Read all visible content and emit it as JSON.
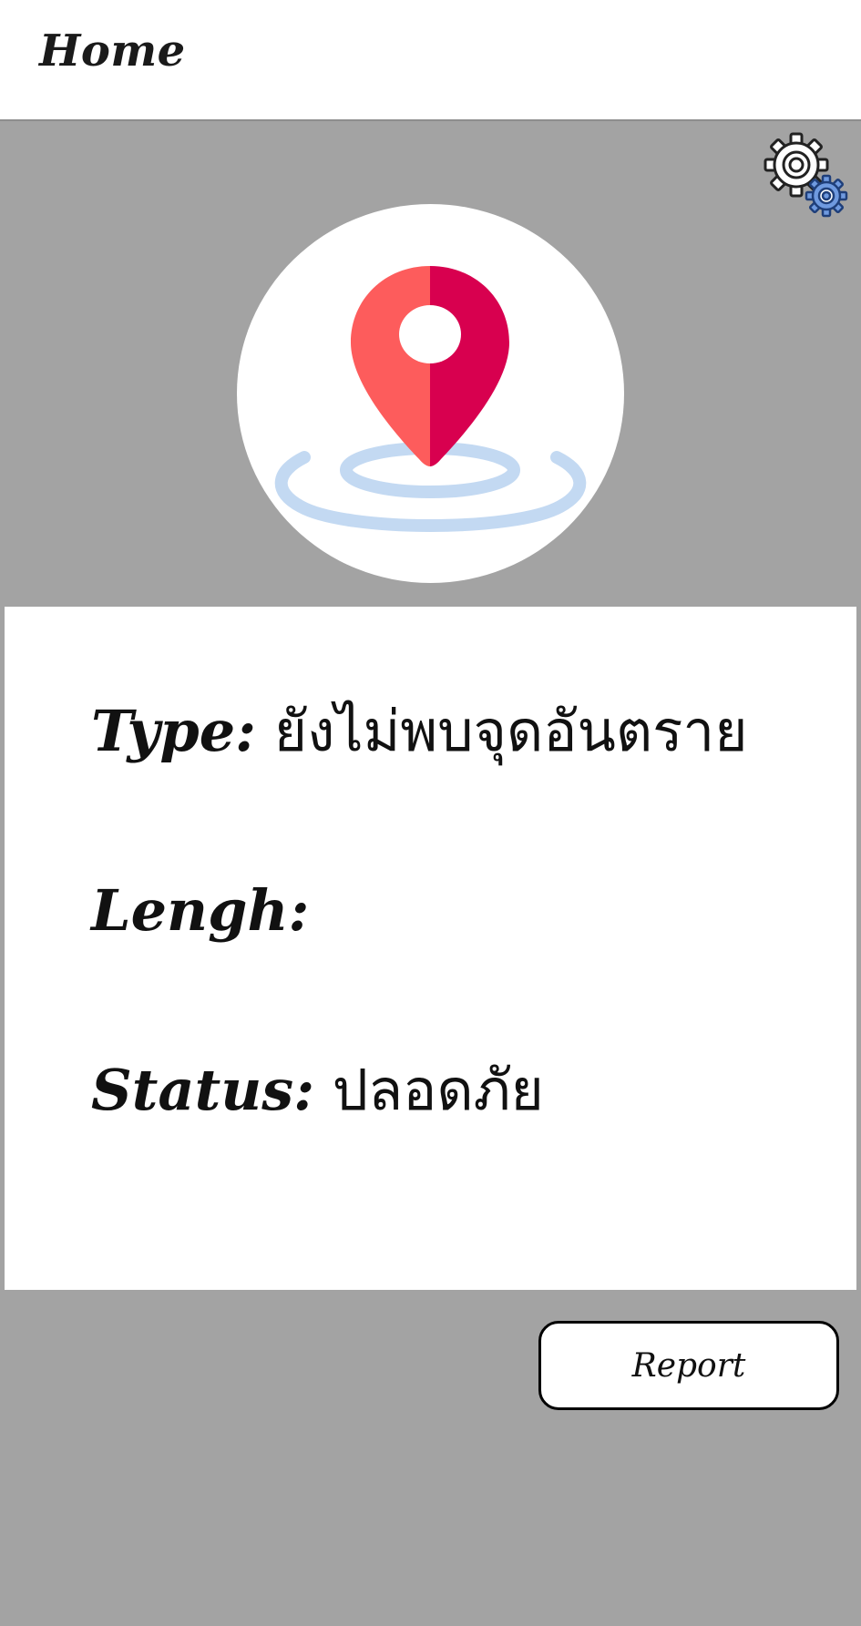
{
  "header": {
    "title": "Home"
  },
  "icons": {
    "settings": "settings-gears-icon",
    "location": "location-pin-icon"
  },
  "info": {
    "type_label": "Type:",
    "type_value": " ยังไม่พบจุดอันตราย",
    "length_label": "Lengh:",
    "length_value": "",
    "status_label": "Status:",
    "status_value": " ปลอดภัย"
  },
  "actions": {
    "report_label": "Report"
  },
  "colors": {
    "background": "#a3a3a3",
    "pin_left": "#fd5c5c",
    "pin_right": "#d8004f",
    "rings": "#c3d9f2",
    "gear_accent": "#6f9ae0"
  }
}
